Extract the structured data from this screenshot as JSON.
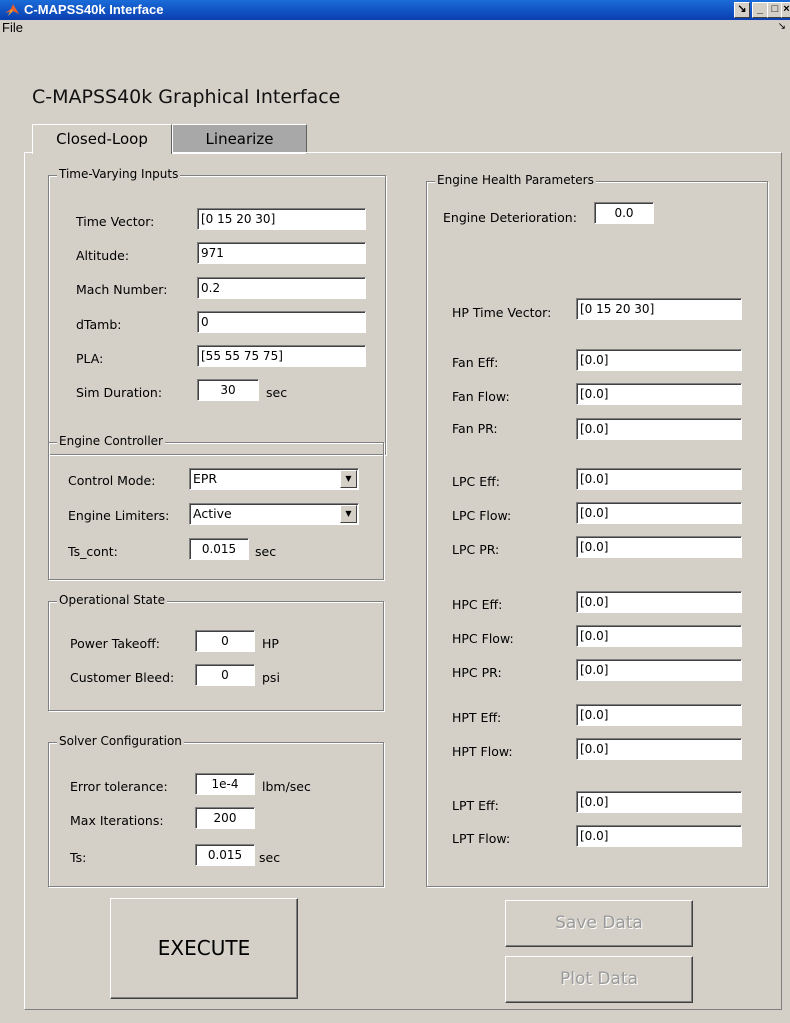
{
  "window": {
    "title": "C-MAPSS40k Interface"
  },
  "menu": {
    "file": "File"
  },
  "app": {
    "heading": "C-MAPSS40k Graphical Interface"
  },
  "tabs": {
    "closed_loop": "Closed-Loop",
    "linearize": "Linearize"
  },
  "time_varying": {
    "title": "Time-Varying Inputs",
    "time_vector_label": "Time Vector:",
    "time_vector": "[0 15 20 30]",
    "altitude_label": "Altitude:",
    "altitude": "971",
    "mach_label": "Mach Number:",
    "mach": "0.2",
    "dtamb_label": "dTamb:",
    "dtamb": "0",
    "pla_label": "PLA:",
    "pla": "[55 55 75 75]",
    "sim_duration_label": "Sim Duration:",
    "sim_duration": "30",
    "sim_duration_unit": "sec"
  },
  "engine_controller": {
    "title": "Engine Controller",
    "control_mode_label": "Control Mode:",
    "control_mode": "EPR",
    "limiters_label": "Engine Limiters:",
    "limiters": "Active",
    "ts_cont_label": "Ts_cont:",
    "ts_cont": "0.015",
    "ts_cont_unit": "sec"
  },
  "operational_state": {
    "title": "Operational State",
    "power_takeoff_label": "Power Takeoff:",
    "power_takeoff": "0",
    "power_takeoff_unit": "HP",
    "customer_bleed_label": "Customer Bleed:",
    "customer_bleed": "0",
    "customer_bleed_unit": "psi"
  },
  "solver": {
    "title": "Solver Configuration",
    "error_tol_label": "Error tolerance:",
    "error_tol": "1e-4",
    "error_tol_unit": "lbm/sec",
    "max_iter_label": "Max Iterations:",
    "max_iter": "200",
    "ts_label": "Ts:",
    "ts": "0.015",
    "ts_unit": "sec"
  },
  "health": {
    "title": "Engine Health Parameters",
    "deterioration_label": "Engine Deterioration:",
    "deterioration": "0.0",
    "hp_time_label": "HP Time Vector:",
    "hp_time": "[0 15 20 30]",
    "fan_eff_label": "Fan Eff:",
    "fan_eff": "[0.0]",
    "fan_flow_label": "Fan Flow:",
    "fan_flow": "[0.0]",
    "fan_pr_label": "Fan PR:",
    "fan_pr": "[0.0]",
    "lpc_eff_label": "LPC Eff:",
    "lpc_eff": "[0.0]",
    "lpc_flow_label": "LPC Flow:",
    "lpc_flow": "[0.0]",
    "lpc_pr_label": "LPC PR:",
    "lpc_pr": "[0.0]",
    "hpc_eff_label": "HPC Eff:",
    "hpc_eff": "[0.0]",
    "hpc_flow_label": "HPC Flow:",
    "hpc_flow": "[0.0]",
    "hpc_pr_label": "HPC PR:",
    "hpc_pr": "[0.0]",
    "hpt_eff_label": "HPT Eff:",
    "hpt_eff": "[0.0]",
    "hpt_flow_label": "HPT Flow:",
    "hpt_flow": "[0.0]",
    "lpt_eff_label": "LPT Eff:",
    "lpt_eff": "[0.0]",
    "lpt_flow_label": "LPT Flow:",
    "lpt_flow": "[0.0]"
  },
  "buttons": {
    "execute": "EXECUTE",
    "save": "Save Data",
    "plot": "Plot Data"
  }
}
